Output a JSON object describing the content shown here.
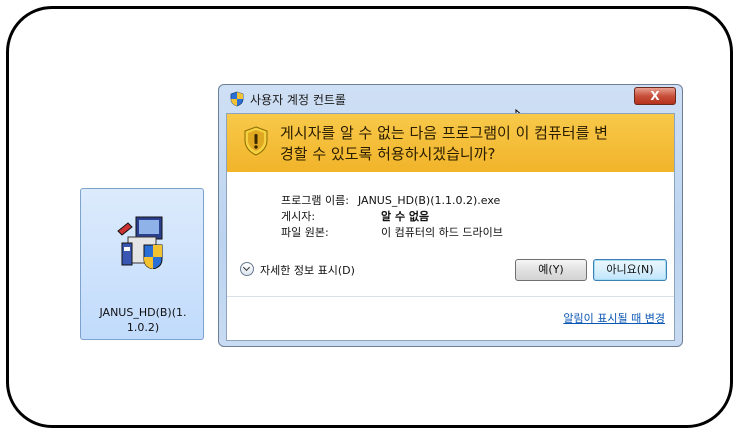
{
  "desktop": {
    "file_label": "JANUS_HD(B)(1.\n1.0.2)",
    "icon": "installer-package-icon"
  },
  "dialog": {
    "title": "사용자 계정 컨트롤",
    "close_label": "X",
    "warning": "게시자를 알 수 없는 다음 프로그램이 이 컴퓨터를 변\n경할 수 있도록 허용하시겠습니까?",
    "program_name_key": "프로그램 이름:",
    "program_name_value": "JANUS_HD(B)(1.1.0.2).exe",
    "publisher_key": "게시자:",
    "publisher_value": "알 수 없음",
    "origin_key": "파일 원본:",
    "origin_value": "이 컴퓨터의 하드 드라이브",
    "details_label": "자세한 정보 표시(D)",
    "yes_label": "예(Y)",
    "no_label": "아니요(N)",
    "change_link": "알림이 표시될 때 변경",
    "warning_color": "#f1b42a",
    "icons": [
      "uac-shield-icon",
      "warning-shield-icon",
      "chevron-down-icon",
      "mouse-cursor-icon"
    ]
  }
}
